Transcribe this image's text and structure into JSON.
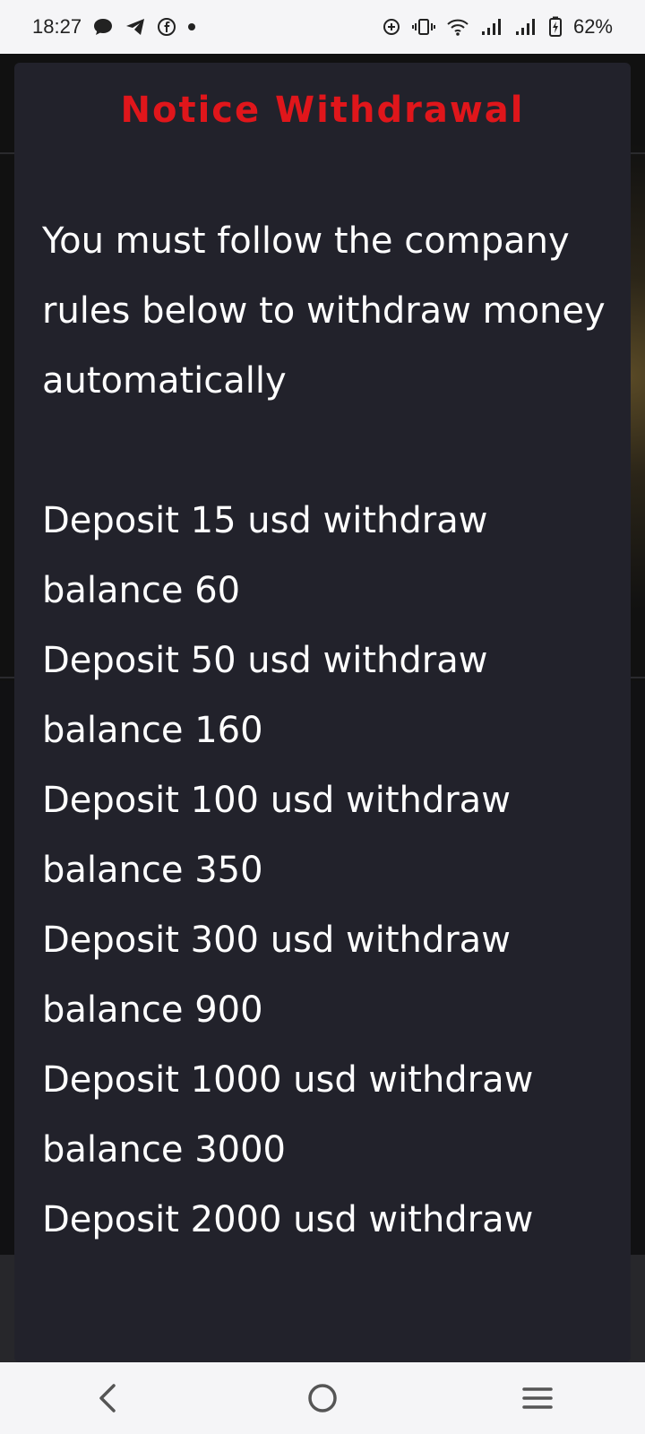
{
  "status_bar": {
    "time": "18:27",
    "notification_icons": [
      "chat-bubble-icon",
      "telegram-icon",
      "facebook-icon",
      "dot-icon"
    ],
    "system_icons": [
      "data-saver-icon",
      "vibrate-icon",
      "wifi-icon",
      "signal-icon",
      "signal-icon",
      "battery-charging-icon"
    ],
    "battery": "62%"
  },
  "modal": {
    "title": "Notice Withdrawal",
    "intro": "You must follow the company rules below to withdraw money automatically",
    "rules": [
      "Deposit 15 usd withdraw balance 60",
      "Deposit 50 usd withdraw balance 160",
      "Deposit 100 usd withdraw balance 350",
      "Deposit 300 usd withdraw balance 900",
      "Deposit 1000 usd withdraw balance 3000",
      "Deposit 2000 usd withdraw"
    ]
  },
  "nav_bar": {
    "items": [
      "back-icon",
      "home-icon",
      "recents-icon"
    ]
  },
  "colors": {
    "title": "#e0161b",
    "modal_bg": "#22222b",
    "text": "#ffffff",
    "bars": "#f5f5f7"
  }
}
